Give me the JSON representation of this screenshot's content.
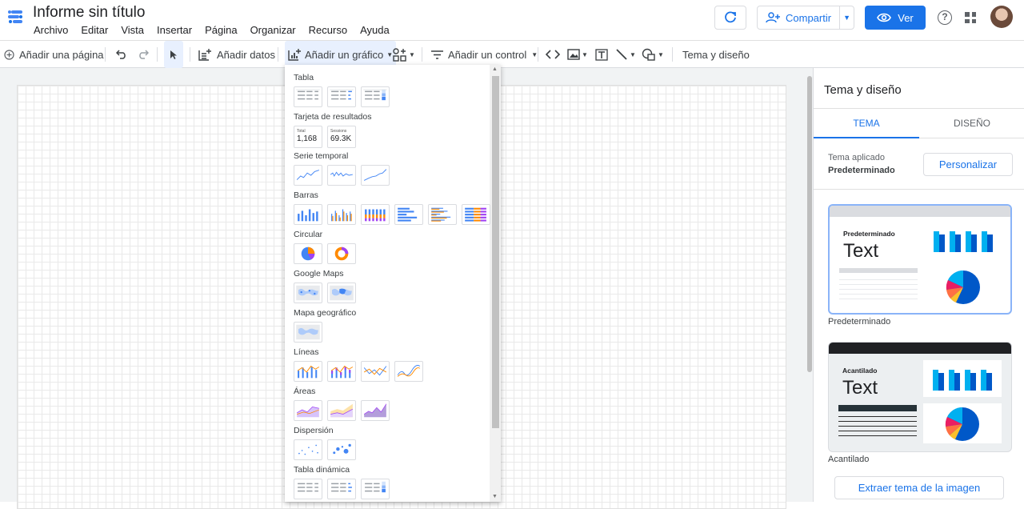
{
  "app": {
    "title": "Informe sin título",
    "menu": [
      "Archivo",
      "Editar",
      "Vista",
      "Insertar",
      "Página",
      "Organizar",
      "Recurso",
      "Ayuda"
    ],
    "share_label": "Compartir",
    "view_label": "Ver",
    "help_glyph": "?"
  },
  "toolbar": {
    "add_page": "Añadir una página",
    "add_data": "Añadir datos",
    "add_chart": "Añadir un gráfico",
    "add_control": "Añadir un control",
    "theme_layout": "Tema y diseño"
  },
  "chart_menu": {
    "sections": [
      {
        "title": "Tabla",
        "kind": "table",
        "count": 3
      },
      {
        "title": "Tarjeta de resultados",
        "kind": "scorecard",
        "cards": [
          {
            "t": "Total",
            "v": "1,168"
          },
          {
            "t": "Sessions",
            "v": "69.3K"
          }
        ]
      },
      {
        "title": "Serie temporal",
        "kind": "timeseries",
        "count": 3
      },
      {
        "title": "Barras",
        "kind": "bars",
        "count": 6
      },
      {
        "title": "Circular",
        "kind": "pie",
        "count": 2
      },
      {
        "title": "Google Maps",
        "kind": "gmap",
        "count": 2
      },
      {
        "title": "Mapa geográfico",
        "kind": "geo",
        "count": 1
      },
      {
        "title": "Líneas",
        "kind": "lines",
        "count": 4
      },
      {
        "title": "Áreas",
        "kind": "areas",
        "count": 3
      },
      {
        "title": "Dispersión",
        "kind": "scatter",
        "count": 2
      },
      {
        "title": "Tabla dinámica",
        "kind": "pivot",
        "count": 3
      }
    ]
  },
  "panel": {
    "title": "Tema y diseño",
    "tabs": [
      "TEMA",
      "DISEÑO"
    ],
    "active_tab": "TEMA",
    "applied_label": "Tema aplicado",
    "applied_value": "Predeterminado",
    "customize": "Personalizar",
    "themes": [
      {
        "name": "Predeterminado",
        "card_label": "Predeterminado",
        "sample": "Text",
        "header_color": "#dadce0",
        "body_color": "#ffffff",
        "selected": true
      },
      {
        "name": "Acantilado",
        "card_label": "Acantilado",
        "sample": "Text",
        "header_color": "#202124",
        "body_color": "#eceff1",
        "selected": false
      }
    ],
    "extract": "Extraer tema de la imagen"
  },
  "colors": {
    "accent": "#1a73e8",
    "chart_blue": "#4285f4",
    "chart_orange": "#ff8a00",
    "theme_cyan": "#00b0f0",
    "theme_navy": "#0058c8"
  }
}
